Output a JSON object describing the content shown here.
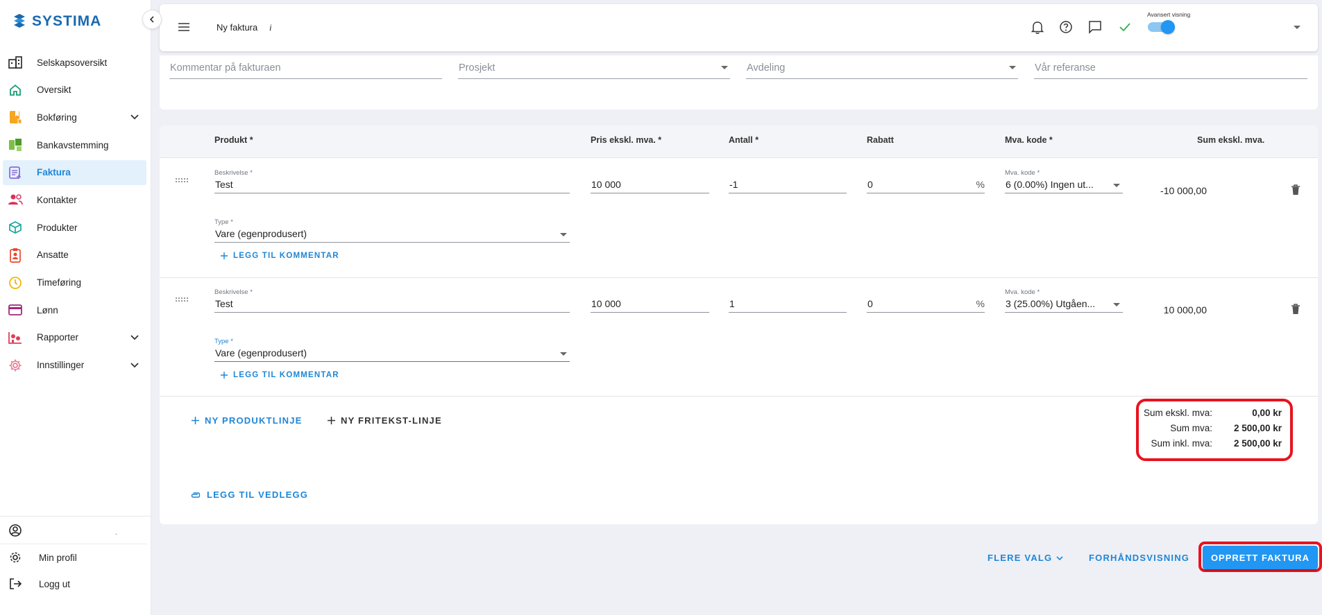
{
  "app": {
    "logo_text": "SYSTIMA"
  },
  "sidebar": {
    "items": [
      {
        "label": "Selskapsoversikt",
        "icon": "building-icon"
      },
      {
        "label": "Oversikt",
        "icon": "home-icon"
      },
      {
        "label": "Bokføring",
        "icon": "ledger-icon",
        "expandable": true
      },
      {
        "label": "Bankavstemming",
        "icon": "bank-reconcile-icon"
      },
      {
        "label": "Faktura",
        "icon": "invoice-icon",
        "active": true
      },
      {
        "label": "Kontakter",
        "icon": "contacts-icon"
      },
      {
        "label": "Produkter",
        "icon": "product-box-icon"
      },
      {
        "label": "Ansatte",
        "icon": "employee-badge-icon"
      },
      {
        "label": "Timeføring",
        "icon": "clock-icon"
      },
      {
        "label": "Lønn",
        "icon": "payroll-card-icon"
      },
      {
        "label": "Rapporter",
        "icon": "reports-icon",
        "expandable": true
      },
      {
        "label": "Innstillinger",
        "icon": "settings-gear-icon",
        "expandable": true
      }
    ],
    "user_name": ".",
    "bottom": [
      {
        "label": "Min profil",
        "icon": "gear-icon"
      },
      {
        "label": "Logg ut",
        "icon": "logout-icon"
      }
    ]
  },
  "topbar": {
    "title": "Ny faktura",
    "info": "i",
    "advanced_label": "Avansert visning",
    "advanced_on": true
  },
  "filters": {
    "comment_placeholder": "Kommentar på fakturaen",
    "project_placeholder": "Prosjekt",
    "department_placeholder": "Avdeling",
    "reference_placeholder": "Vår referanse"
  },
  "table": {
    "headers": {
      "product": "Produkt *",
      "price": "Pris ekskl. mva. *",
      "qty": "Antall *",
      "discount": "Rabatt",
      "vat": "Mva. kode *",
      "sum": "Sum ekskl. mva."
    },
    "rows": [
      {
        "desc_label": "Beskrivelse *",
        "desc": "Test",
        "price": "10 000",
        "qty": "-1",
        "discount": "0",
        "discount_unit": "%",
        "vat_label": "Mva. kode *",
        "vat": "6 (0.00%) Ingen ut...",
        "sum": "-10 000,00",
        "type_label": "Type *",
        "type": "Vare (egenprodusert)",
        "add_comment": "LEGG TIL KOMMENTAR"
      },
      {
        "desc_label": "Beskrivelse *",
        "desc": "Test",
        "price": "10 000",
        "qty": "1",
        "discount": "0",
        "discount_unit": "%",
        "vat_label": "Mva. kode *",
        "vat": "3 (25.00%) Utgåen...",
        "sum": "10 000,00",
        "type_label": "Type *",
        "type": "Vare (egenprodusert)",
        "add_comment": "LEGG TIL KOMMENTAR"
      }
    ]
  },
  "actions": {
    "new_product_line": "NY PRODUKTLINJE",
    "new_text_line": "NY FRITEKST-LINJE",
    "add_attachment": "LEGG TIL VEDLEGG"
  },
  "totals": {
    "excl_label": "Sum ekskl. mva:",
    "excl_value": "0,00 kr",
    "vat_label": "Sum mva:",
    "vat_value": "2 500,00 kr",
    "incl_label": "Sum inkl. mva:",
    "incl_value": "2 500,00 kr"
  },
  "footer": {
    "more_options": "FLERE VALG",
    "preview": "FORHÅNDSVISNING",
    "create": "OPPRETT FAKTURA"
  },
  "colors": {
    "accent": "#2196f3",
    "highlight": "#e8131f",
    "active_nav_bg": "#e3f1fc"
  }
}
